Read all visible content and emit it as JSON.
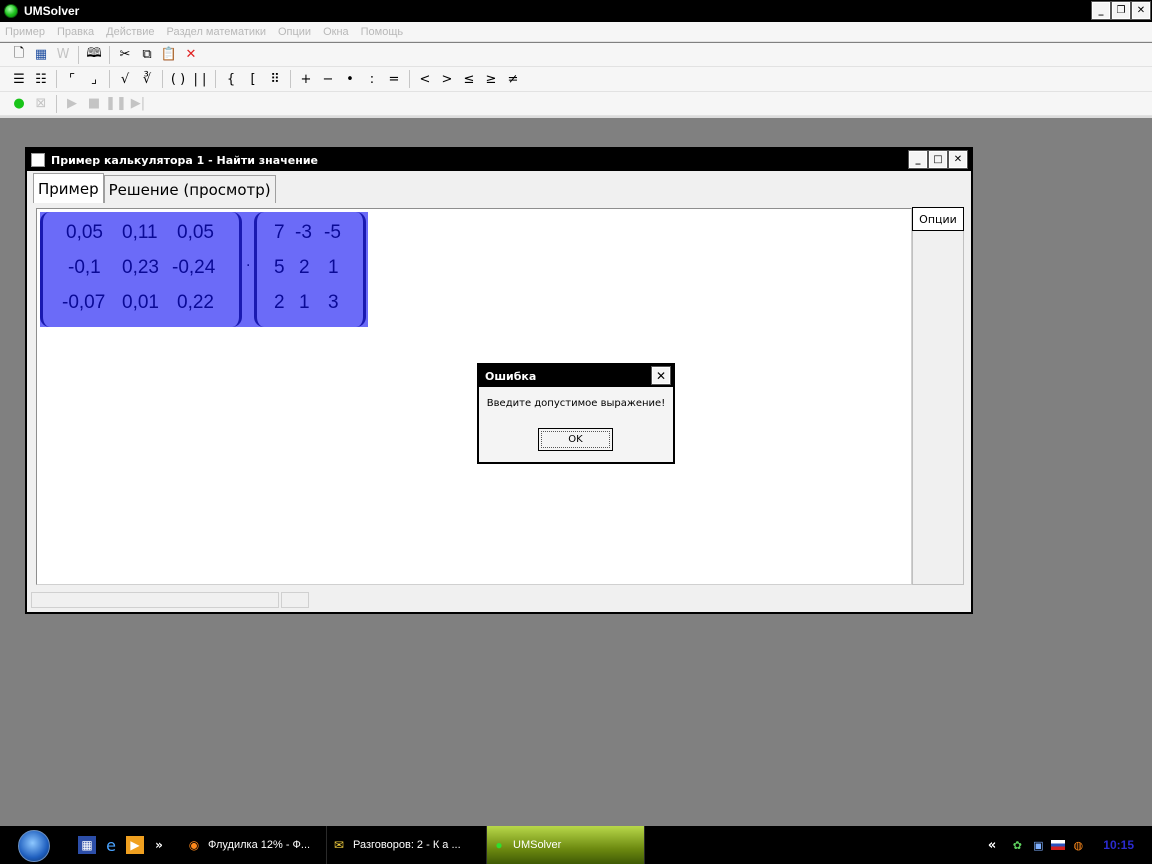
{
  "app": {
    "title": "UMSolver",
    "menu": [
      "Пример",
      "Правка",
      "Действие",
      "Раздел математики",
      "Опции",
      "Окна",
      "Помощь"
    ]
  },
  "toolbar1": [
    {
      "name": "new-doc-icon",
      "glyph": "🗋",
      "disabled": false
    },
    {
      "name": "table-icon",
      "glyph": "▦",
      "disabled": false
    },
    {
      "name": "word-icon",
      "glyph": "W",
      "disabled": true
    },
    {
      "name": "preview-icon",
      "glyph": "🕮",
      "disabled": false
    },
    {
      "name": "cut-icon",
      "glyph": "✂",
      "disabled": false
    },
    {
      "name": "copy-icon",
      "glyph": "⧉",
      "disabled": false
    },
    {
      "name": "paste-icon",
      "glyph": "📋",
      "disabled": false
    },
    {
      "name": "delete-icon",
      "glyph": "✕",
      "disabled": false
    }
  ],
  "toolbar2": [
    {
      "name": "insert-row-above-icon",
      "glyph": "☰"
    },
    {
      "name": "insert-row-below-icon",
      "glyph": "☷"
    },
    {
      "name": "superscript-icon",
      "glyph": "⌜"
    },
    {
      "name": "subscript-icon",
      "glyph": "⌟"
    },
    {
      "name": "sqrt-icon",
      "glyph": "√"
    },
    {
      "name": "nth-root-icon",
      "glyph": "∛"
    },
    {
      "name": "parentheses-icon",
      "glyph": "( )"
    },
    {
      "name": "abs-icon",
      "glyph": "| |"
    },
    {
      "name": "brace-icon",
      "glyph": "{"
    },
    {
      "name": "bracket-icon",
      "glyph": "["
    },
    {
      "name": "matrix-icon",
      "glyph": "⠿"
    },
    {
      "name": "plus-icon",
      "glyph": "+"
    },
    {
      "name": "minus-icon",
      "glyph": "−"
    },
    {
      "name": "multiply-icon",
      "glyph": "•"
    },
    {
      "name": "divide-icon",
      "glyph": ":"
    },
    {
      "name": "equals-icon",
      "glyph": "="
    },
    {
      "name": "less-icon",
      "glyph": "<"
    },
    {
      "name": "greater-icon",
      "glyph": ">"
    },
    {
      "name": "less-equal-icon",
      "glyph": "≤"
    },
    {
      "name": "greater-equal-icon",
      "glyph": "≥"
    },
    {
      "name": "not-equal-icon",
      "glyph": "≠"
    }
  ],
  "toolbar3": [
    {
      "name": "run-icon",
      "glyph": "●",
      "disabled": false
    },
    {
      "name": "clear-icon",
      "glyph": "⊠",
      "disabled": true
    },
    {
      "name": "play-icon",
      "glyph": "▶",
      "disabled": true
    },
    {
      "name": "stop-icon",
      "glyph": "■",
      "disabled": true
    },
    {
      "name": "pause-icon",
      "glyph": "❚❚",
      "disabled": true
    },
    {
      "name": "step-icon",
      "glyph": "▶|",
      "disabled": true
    }
  ],
  "child_window": {
    "title": "Пример калькулятора 1 - Найти значение",
    "tabs": [
      "Пример",
      "Решение (просмотр)"
    ],
    "options_button": "Опции"
  },
  "expression": {
    "matrix_a": [
      [
        "0,05",
        "0,11",
        "0,05"
      ],
      [
        "-0,1",
        "0,23",
        "-0,24"
      ],
      [
        "-0,07",
        "0,01",
        "0,22"
      ]
    ],
    "operator": "·",
    "matrix_b": [
      [
        "7",
        "-3",
        "-5"
      ],
      [
        "5",
        "2",
        "1"
      ],
      [
        "2",
        "1",
        "3"
      ]
    ]
  },
  "dialog": {
    "title": "Ошибка",
    "message": "Введите допустимое выражение!",
    "ok_label": "OK"
  },
  "taskbar": {
    "tasks": [
      {
        "label": "Флудилка 12% - Ф...",
        "active": false,
        "icon": "firefox-icon"
      },
      {
        "label": "Разговоров: 2 - К а ...",
        "active": false,
        "icon": "chat-icon"
      },
      {
        "label": "UMSolver",
        "active": true,
        "icon": "umsolver-icon"
      }
    ],
    "tray_chevron": "«",
    "clock": "10:15"
  }
}
